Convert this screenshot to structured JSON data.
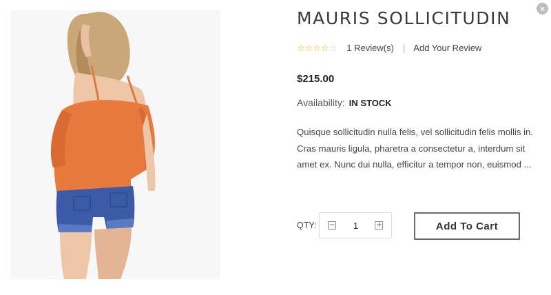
{
  "product": {
    "title": "MAURIS SOLLICITUDIN",
    "rating": {
      "stars_filled": 4,
      "stars_total": 5
    },
    "reviews_link": "1 Review(s)",
    "separator": "|",
    "add_review_link": "Add Your Review",
    "price": "$215.00",
    "availability_label": "Availability:",
    "availability_value": "IN STOCK",
    "description": "Quisque sollicitudin nulla felis, vel sollicitudin felis mollis in. Cras mauris ligula, pharetra a consectetur a, interdum sit amet ex. Nunc dui nulla, efficitur a tempor non, euismod ..."
  },
  "quantity": {
    "label": "QTY:",
    "value": "1"
  },
  "actions": {
    "add_to_cart": "Add To Cart",
    "close": "×"
  },
  "colors": {
    "star": "#f0a800",
    "top": "#e8793f",
    "shorts": "#3b5aa8"
  }
}
